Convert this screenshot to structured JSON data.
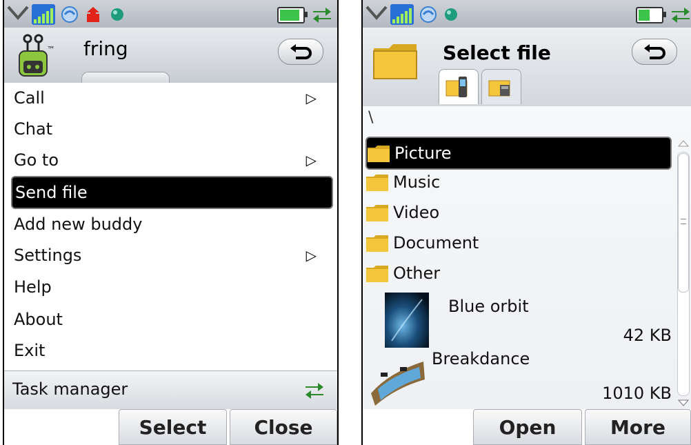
{
  "left": {
    "app_title": "fring",
    "menu": [
      {
        "label": "Call",
        "submenu": true
      },
      {
        "label": "Chat",
        "submenu": false
      },
      {
        "label": "Go to",
        "submenu": true
      },
      {
        "label": "Send file",
        "submenu": false,
        "selected": true
      },
      {
        "label": "Add new buddy",
        "submenu": false
      },
      {
        "label": "Settings",
        "submenu": true
      },
      {
        "label": "Help",
        "submenu": false
      },
      {
        "label": "About",
        "submenu": false
      },
      {
        "label": "Exit",
        "submenu": false
      }
    ],
    "task_manager": "Task manager",
    "softkeys": {
      "left": "Select",
      "right": "Close"
    }
  },
  "right": {
    "title": "Select file",
    "path": "\\",
    "folders": [
      "Picture",
      "Music",
      "Video",
      "Document",
      "Other"
    ],
    "files": [
      {
        "name": "Blue orbit",
        "size": "42 KB"
      },
      {
        "name": "Breakdance",
        "size": "1010 KB"
      }
    ],
    "softkeys": {
      "left": "Open",
      "right": "More"
    }
  },
  "colors": {
    "selection": "#000000",
    "signal": "#2a6fd6",
    "battery": "#3cc34a",
    "folder": "#f5c63c"
  }
}
